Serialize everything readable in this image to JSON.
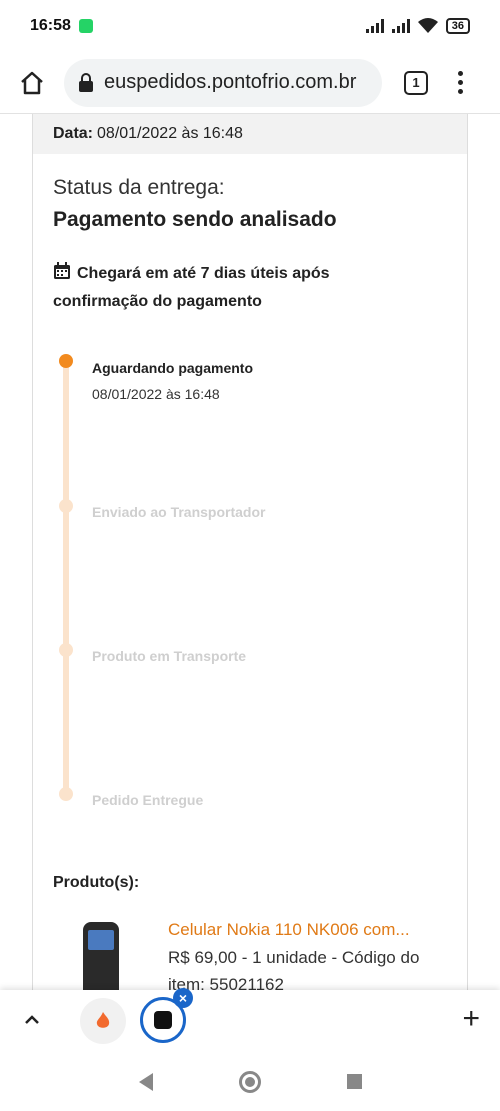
{
  "statusbar": {
    "time": "16:58",
    "battery": "36"
  },
  "browser": {
    "url": "euspedidos.pontofrio.com.br",
    "tab_count": "1"
  },
  "order": {
    "date_label": "Data:",
    "date_value": "08/01/2022 às 16:48",
    "status_label": "Status da entrega:",
    "status_value": "Pagamento sendo analisado",
    "eta": "Chegará em até 7 dias úteis após confirmação do pagamento"
  },
  "timeline": [
    {
      "title": "Aguardando pagamento",
      "date": "08/01/2022 às 16:48",
      "active": true
    },
    {
      "title": "Enviado ao Transportador",
      "date": "",
      "active": false
    },
    {
      "title": "Produto em Transporte",
      "date": "",
      "active": false
    },
    {
      "title": "Pedido Entregue",
      "date": "",
      "active": false
    }
  ],
  "products": {
    "heading": "Produto(s):",
    "items": [
      {
        "name": "Celular Nokia 110 NK006 com...",
        "info": "R$ 69,00 - 1 unidade - Código do item: 55021162"
      }
    ]
  },
  "colors": {
    "accent": "#f28a1e",
    "timeline_track": "#fbe3cc",
    "link": "#e07a16",
    "tab_active": "#1a66c9"
  }
}
